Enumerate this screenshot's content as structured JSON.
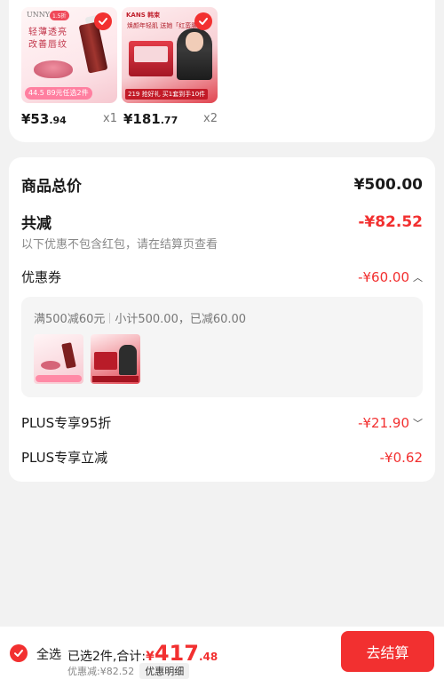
{
  "products": [
    {
      "price_int": "¥53",
      "price_dec": ".94",
      "qty": "x1",
      "image": {
        "brand": "UNNY",
        "badge": "1.5折",
        "headline_line1": "轻薄透亮",
        "headline_line2": "改善唇纹",
        "promo": "44.5 89元任选2件"
      }
    },
    {
      "price_int": "¥181",
      "price_dec": ".77",
      "qty": "x2",
      "image": {
        "brand": "KANS 韩束",
        "headline": "焕颜年轻肌 送她「红蛮腰」",
        "promo": "219 抢好礼 买1套到手10件"
      }
    }
  ],
  "summary": {
    "total_label": "商品总价",
    "total_value": "¥500.00",
    "reduce_label": "共减",
    "reduce_value": "-¥82.52",
    "note": "以下优惠不包含红包，请在结算页查看",
    "coupon_label": "优惠券",
    "coupon_value": "-¥60.00",
    "coupon_rule": "满500减60元",
    "coupon_subtotal": "小计500.00，已减60.00",
    "plus_discount_label": "PLUS专享95折",
    "plus_discount_value": "-¥21.90",
    "plus_reduce_label": "PLUS专享立减",
    "plus_reduce_value": "-¥0.62"
  },
  "bottom": {
    "select_all": "全选",
    "selected_text": "已选2件,合计:",
    "currency": "¥",
    "total_int": "417",
    "total_dec": ".48",
    "discount_text": "优惠减:¥82.52",
    "detail_label": "优惠明细",
    "checkout_label": "去结算"
  },
  "colors": {
    "accent": "#f23030",
    "background": "#f2f2f2"
  },
  "icons": [
    "check-icon",
    "chevron-up-icon",
    "chevron-down-icon"
  ]
}
